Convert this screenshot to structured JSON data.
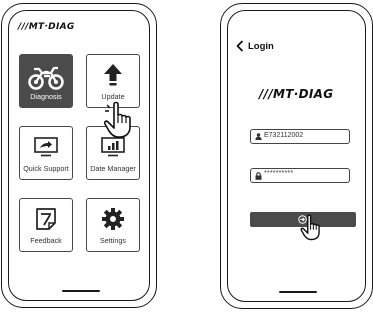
{
  "left_screen": {
    "brand": "///MT·DIAG",
    "tiles": [
      {
        "label": "Diagnosis",
        "icon": "motorcycle-icon",
        "active": true
      },
      {
        "label": "Update",
        "icon": "upload-arrow-icon",
        "active": false
      },
      {
        "label": "Quick Support",
        "icon": "remote-monitor-icon",
        "active": false
      },
      {
        "label": "Date Manager",
        "icon": "bar-chart-monitor-icon",
        "active": false
      },
      {
        "label": "Feedback",
        "icon": "feedback-note-icon",
        "active": false
      },
      {
        "label": "Settings",
        "icon": "gear-icon",
        "active": false
      }
    ]
  },
  "right_screen": {
    "back_label": "Login",
    "brand": "///MT·DIAG",
    "username_value": "E732112002",
    "password_value": "**********",
    "login_button_icon": "login-arrow-icon"
  },
  "colors": {
    "active_tile": "#4b4b4b",
    "button": "#4b4b4b",
    "outline": "#1a1a1a"
  }
}
